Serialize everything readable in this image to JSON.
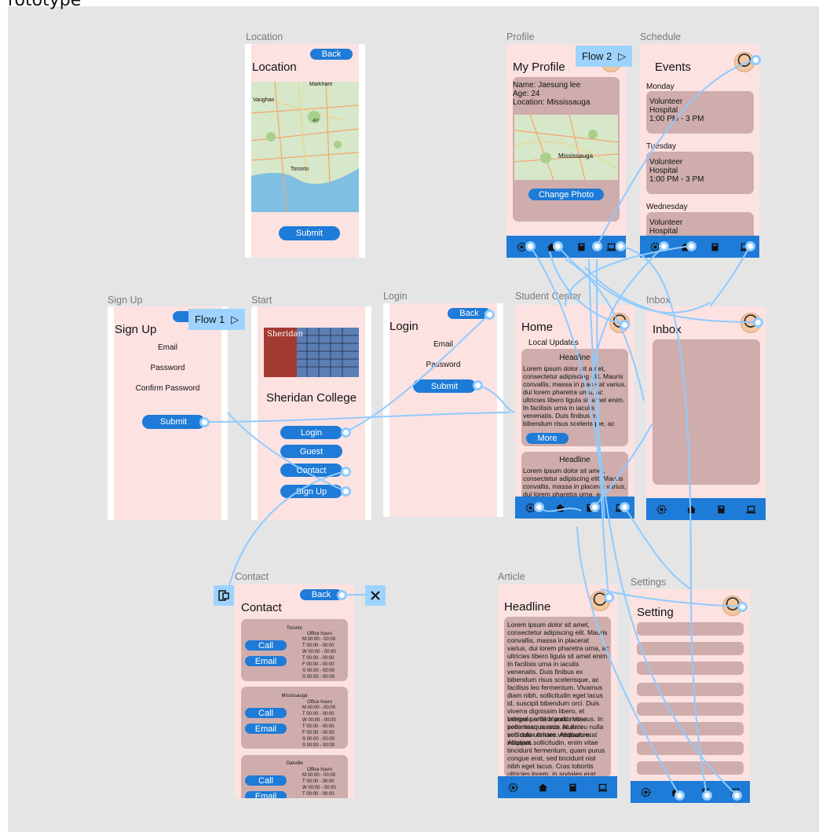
{
  "page": {
    "title": "rototype"
  },
  "flows": {
    "flow1": "Flow 1",
    "flow2": "Flow 2",
    "play": "▷"
  },
  "frames": {
    "location": {
      "label": "Location",
      "title": "Location",
      "back": "Back",
      "submit": "Submit",
      "map_labels": [
        "Markham",
        "Vaughan",
        "Toronto",
        "407"
      ]
    },
    "profile": {
      "label": "Profile",
      "title": "My Profile",
      "name": "Name: Jaesung lee",
      "age": "Age: 24",
      "location": "Location: Mississauga",
      "map_label": "Mississauga",
      "change_photo": "Change Photo"
    },
    "schedule": {
      "label": "Schedule",
      "title": "Events",
      "days": [
        {
          "day": "Monday",
          "lines": [
            "Volunteer",
            "Hospital",
            "1:00 PM - 3 PM"
          ]
        },
        {
          "day": "Tuesday",
          "lines": [
            "Volunteer",
            "Hospital",
            "1:00 PM - 3 PM"
          ]
        },
        {
          "day": "Wednesday",
          "lines": [
            "Volunteer",
            "Hospital"
          ]
        }
      ]
    },
    "signup": {
      "label": "Sign Up",
      "title": "Sign Up",
      "back": "B",
      "email": "Email",
      "password": "Password",
      "confirm": "Confirm Password",
      "submit": "Submit"
    },
    "start": {
      "label": "Start",
      "college": "Sheridan College",
      "logo": "Sheridan",
      "login": "Login",
      "guest": "Guest",
      "contact": "Contact",
      "signup": "Sign Up"
    },
    "login": {
      "label": "Login",
      "title": "Login",
      "back": "Back",
      "email": "Email",
      "password": "Password",
      "submit": "Submit"
    },
    "student": {
      "label": "Student Center",
      "title": "Home",
      "local": "Local Updates",
      "headline1": "Headline",
      "body1": "Lorem ipsum dolor sit amet, consectetur adipiscing elit. Mauris convallis, massa in placerat varius, dui lorem pharetra urna, ac ultricies libero ligula sit amet enim. In facilisis urna in iaculis venenatis. Duis finibus ex bibendum risus scelerisque, ac facilisis leo fermentum. Vivamus diam nibh, sollicitudin eget lacus id, suscipit",
      "more": "More",
      "headline2": "Headline",
      "body2": "Lorem ipsum dolor sit amet, consectetur adipiscing elit. Mauris convallis, massa in placerat varius, dui lorem pharetra urna, ac ultricies libero ligula sit amet"
    },
    "inbox": {
      "label": "Inbox",
      "title": "Inbox"
    },
    "contact": {
      "label": "Contact",
      "title": "Contact",
      "back": "Back",
      "hours_title": "Office hours",
      "hours": [
        "M 00:00 - 00:00",
        "T 00:00 - 00:00",
        "W 00:00 - 00:00",
        "T 00:00 - 00:00",
        "F 00:00 - 00:00",
        "S 00:00 - 00:00",
        "S 00:00 - 00:00"
      ],
      "campuses": [
        "Toronto",
        "Mississauga",
        "Oakville"
      ],
      "call": "Call",
      "email": "Email"
    },
    "article": {
      "label": "Article",
      "title": "Headline",
      "para1": "Lorem ipsum dolor sit amet, consectetur adipiscing elit. Mauris convallis, massa in placerat varius, dui lorem pharetra urna, ac ultricies libero ligula sit amet enim. In facilisis urna in iaculis venenatis. Duis finibus ex bibendum risus scelerisque, ac facilisis leo fermentum. Vivamus diam nibh, sollicitudin eget lacus id, suscipit bibendum orci. Duis viverra dignissim libero, et vehicula ante blandit rhoncus. In pellentesque ante ac ante vehicula ultricies. Aliquam erat volutpat.",
      "para2": "Integer porttitor purus vitae accumsan cursus. Nulla eu nulla sed dolor ornare vestibulum. Aliquam sollicitudin, enim vitae tincidunt fermentum, quam purus congue erat, sed tincidunt nisl nibh eget lacus. Cras lobortis ultricies lorem, in sodales erat blandit non. Praesent in condimentum enim. Aliquam dui erat, sagittis sed dictum"
    },
    "settings": {
      "label": "Settings",
      "title": "Setting"
    }
  },
  "colors": {
    "frame": "#fde2e2",
    "card": "#cfadad",
    "button": "#1e7bd7",
    "wire": "#8fcbff",
    "canvas": "#e5e5e5"
  },
  "icons": [
    "gear-icon",
    "home-icon",
    "calculator-icon",
    "laptop-icon",
    "close-icon",
    "device-icon"
  ]
}
